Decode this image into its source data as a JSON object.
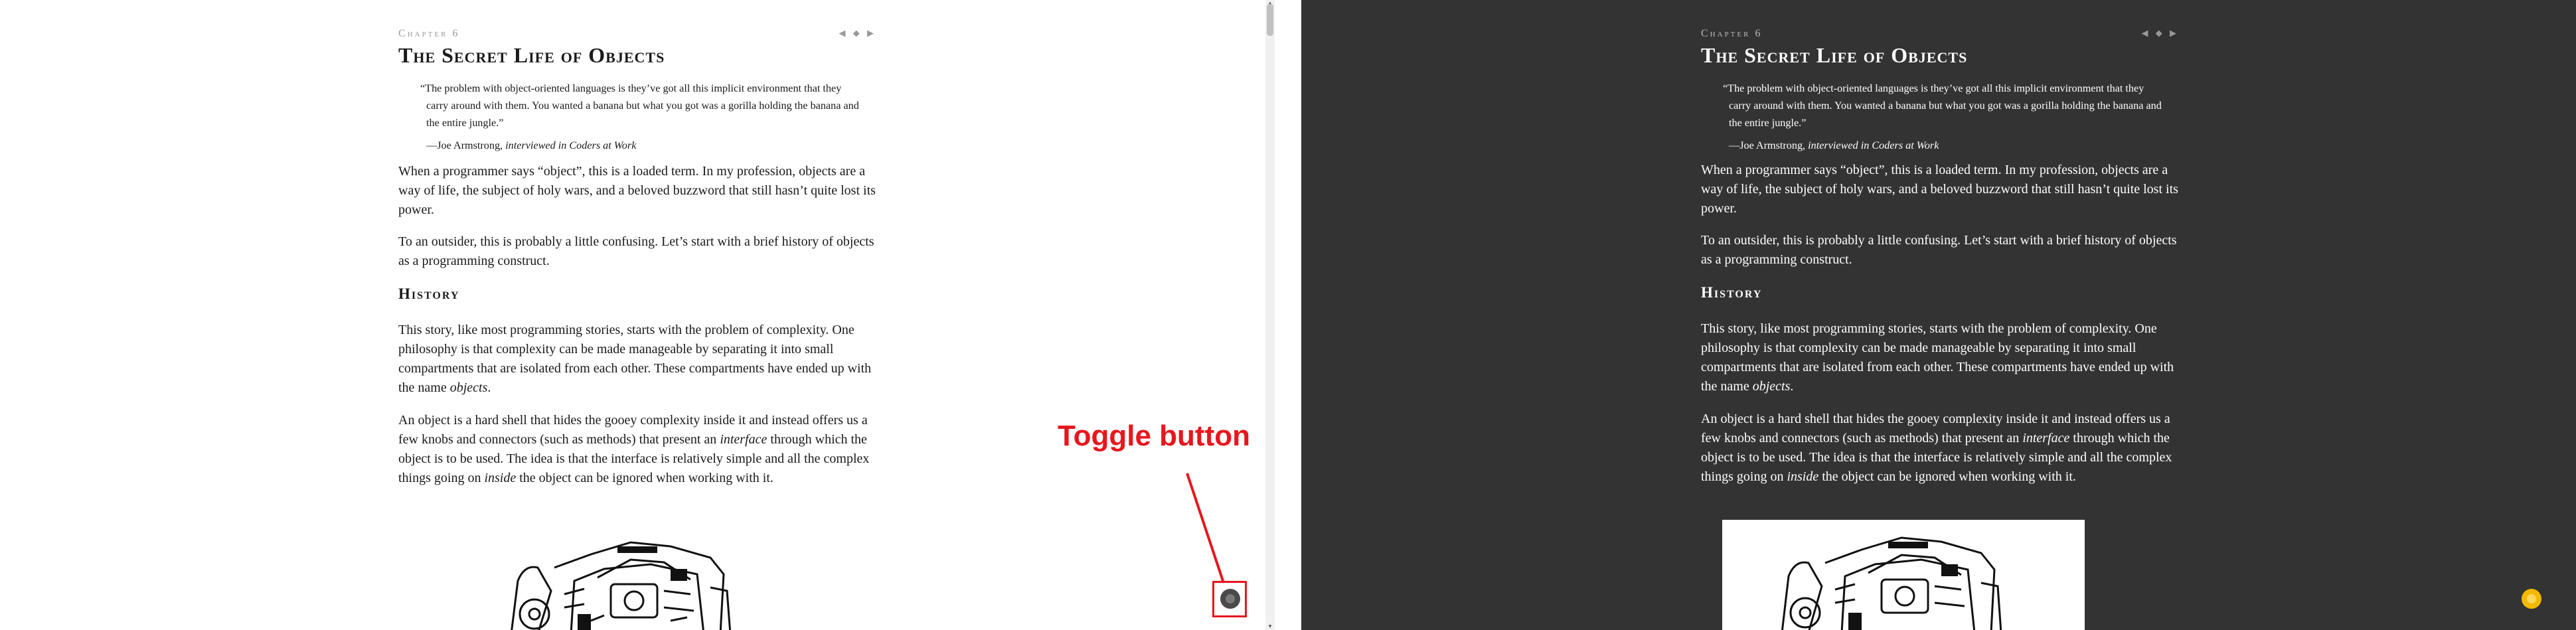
{
  "chapter": {
    "label": "Chapter 6",
    "nav_icons": "◀ ◆ ▶",
    "title": "The Secret Life of Objects"
  },
  "epigraph": {
    "quote": "“The problem with object-oriented languages is they’ve got all this implicit environment that they carry around with them. You wanted a banana but what you got was a gorilla holding the banana and the entire jungle.”",
    "author": "—Joe Armstrong, ",
    "source": "interviewed in Coders at Work"
  },
  "paragraphs": {
    "p1": "When a programmer says “object”, this is a loaded term. In my profession, objects are a way of life, the subject of holy wars, and a beloved buzzword that still hasn’t quite lost its power.",
    "p2": "To an outsider, this is probably a little confusing. Let’s start with a brief history of objects as a programming construct.",
    "history_heading": "History",
    "p3_a": "This story, like most programming stories, starts with the problem of complexity. One philosophy is that complexity can be made manageable by separating it into small compartments that are isolated from each other. These compartments have ended up with the name ",
    "p3_em": "objects",
    "p3_b": ".",
    "p4_a": "An object is a hard shell that hides the gooey complexity inside it and instead offers us a few knobs and connectors (such as methods) that present an ",
    "p4_em1": "interface",
    "p4_b": " through which the object is to be used. The idea is that the interface is relatively simple and all the complex things going on ",
    "p4_em2": "inside",
    "p4_c": " the object can be ignored when working with it."
  },
  "annotation": {
    "label": "Toggle button",
    "color": "#e8161d"
  },
  "theme": {
    "light_background": "#ffffff",
    "dark_background": "#333333",
    "dark_toggle_color": "#f2b900"
  },
  "icons": {
    "toggle_light": "theme-toggle-icon",
    "toggle_dark": "sun-icon",
    "illustration": "machine-illustration"
  }
}
